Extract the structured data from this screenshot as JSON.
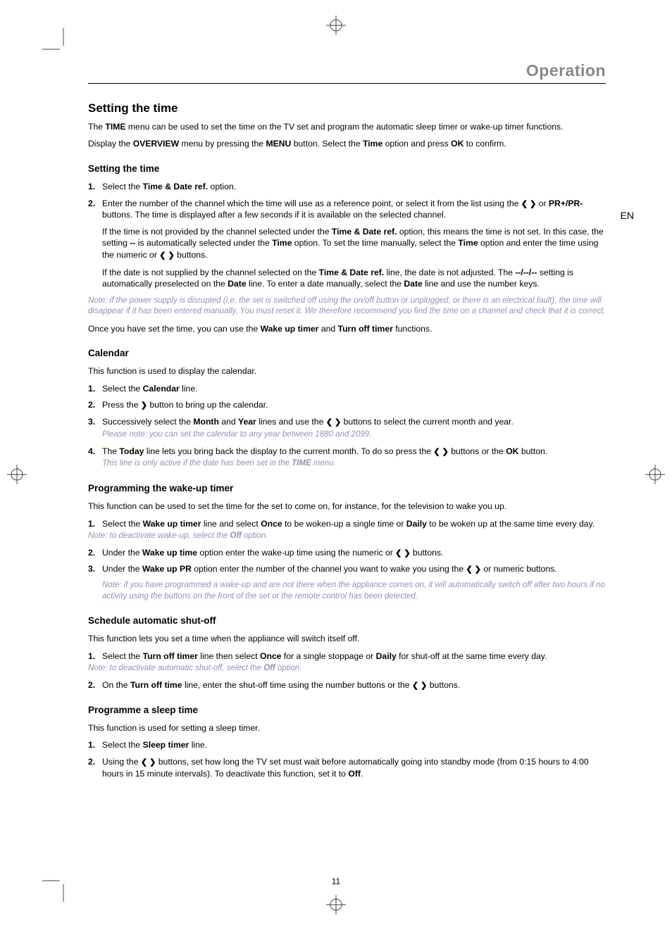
{
  "lang": "EN",
  "header": "Operation",
  "h1": "Setting the time",
  "intro_p1a": "The ",
  "intro_p1b": "TIME",
  "intro_p1c": " menu can be used to set the time on the TV set and program the automatic sleep timer or wake-up timer functions.",
  "intro_p2a": "Display the ",
  "intro_p2b": "OVERVIEW",
  "intro_p2c": " menu by pressing the ",
  "intro_p2d": "MENU",
  "intro_p2e": " button. Select the ",
  "intro_p2f": "Time",
  "intro_p2g": " option and press ",
  "intro_p2h": "OK",
  "intro_p2i": " to confirm.",
  "s1": {
    "title": "Setting the time",
    "li1a": "Select the ",
    "li1b": "Time & Date ref.",
    "li1c": " option.",
    "li2a": "Enter the number of the channel which the time will use as a reference point, or select it from the list using the ",
    "li2b": " or ",
    "li2c": "PR+/PR-",
    "li2d": " buttons. The time is displayed after a few seconds if it is available on the selected channel.",
    "li2p2a": "If the time is not provided by the channel selected under the ",
    "li2p2b": "Time & Date ref.",
    "li2p2c": " option, this means the time is not set. In this case, the setting ",
    "li2p2d": "--",
    "li2p2e": " is automatically selected under the ",
    "li2p2f": "Time",
    "li2p2g": " option. To set the time manually, select the ",
    "li2p2h": "Time",
    "li2p2i": " option and enter the time using the numeric or ",
    "li2p2j": " buttons.",
    "li2p3a": "If the date is not supplied by the channel selected on the ",
    "li2p3b": "Time & Date ref.",
    "li2p3c": " line, the date is not adjusted. The ",
    "li2p3d": "--/--/--",
    "li2p3e": " setting is automatically preselected on the ",
    "li2p3f": "Date",
    "li2p3g": " line. To enter a date manually, select the ",
    "li2p3h": "Date",
    "li2p3i": " line and use the number keys.",
    "note": "Note: if the power supply is disrupted (i.e. the set is switched off using the on/off button or unplugged, or there is an electrical fault), the time will disappear if it has been entered manually. You must reset it. We therefore recommend you find the time on a channel and check that it is correct.",
    "after_a": "Once you have set the time, you can use the ",
    "after_b": "Wake up timer",
    "after_c": " and ",
    "after_d": "Turn off timer",
    "after_e": " functions."
  },
  "s2": {
    "title": "Calendar",
    "intro": "This function is used to display the calendar.",
    "li1a": "Select the ",
    "li1b": "Calendar",
    "li1c": " line.",
    "li2a": "Press the ",
    "li2b": " button to bring up the calendar.",
    "li3a": "Successively select the ",
    "li3b": "Month",
    "li3c": " and ",
    "li3d": "Year",
    "li3e": " lines and use the ",
    "li3f": " buttons to select the current month and year.",
    "li3note": "Please note: you can set the calendar to any year between 1880 and 2099.",
    "li4a": "The ",
    "li4b": "Today",
    "li4c": " line lets you bring back the display to the current month. To do so press the ",
    "li4d": " buttons or the ",
    "li4e": "OK",
    "li4f": " button.",
    "li4note_a": "This line is only active if the date has been set in the ",
    "li4note_b": "TIME",
    "li4note_c": " menu."
  },
  "s3": {
    "title": "Programming the wake-up timer",
    "intro": "This function can be used to set the time for the set to come on, for instance, for the television to wake you up.",
    "li1a": "Select the ",
    "li1b": "Wake up timer",
    "li1c": " line and select ",
    "li1d": "Once",
    "li1e": " to be woken-up a single time or ",
    "li1f": "Daily",
    "li1g": " to be woken up at the same time every day.",
    "li1note_a": "Note: to deactivate wake-up, select the ",
    "li1note_b": "Off",
    "li1note_c": " option.",
    "li2a": "Under the ",
    "li2b": "Wake up time",
    "li2c": " option enter the wake-up time using the numeric or ",
    "li2d": " buttons.",
    "li3a": "Under the ",
    "li3b": "Wake up PR",
    "li3c": " option enter the number of the channel you want to wake you using the ",
    "li3d": " or numeric buttons.",
    "note": "Note: if you have programmed a wake-up and are not there when the appliance comes on, it will automatically switch off after two hours if no activity using the buttons on the front of the set or the remote control has been detected."
  },
  "s4": {
    "title": "Schedule automatic shut-off",
    "intro": "This function lets you set a time when the appliance will switch itself off.",
    "li1a": "Select the ",
    "li1b": "Turn off timer",
    "li1c": " line then select ",
    "li1d": "Once",
    "li1e": " for a single stoppage or ",
    "li1f": "Daily",
    "li1g": " for shut-off at the same time every day.",
    "li1note_a": "Note: to deactivate automatic shut-off, select the ",
    "li1note_b": "Off",
    "li1note_c": " option.",
    "li2a": "On the ",
    "li2b": "Turn off time",
    "li2c": " line, enter the shut-off time using the number buttons or the ",
    "li2d": " buttons."
  },
  "s5": {
    "title": "Programme a sleep time",
    "intro": "This function is used for setting a sleep timer.",
    "li1a": "Select the ",
    "li1b": "Sleep timer",
    "li1c": " line.",
    "li2a": "Using the ",
    "li2b": " buttons, set how long the TV set must wait before automatically going into standby mode (from 0:15 hours to 4:00 hours in 15 minute intervals). To deactivate this function, set it to ",
    "li2c": "Off",
    "li2d": "."
  },
  "labels": {
    "n1": "1.",
    "n2": "2.",
    "n3": "3.",
    "n4": "4.",
    "left_arrow": "❮",
    "right_arrow": "❯",
    "lr_arrow": "❮ ❯"
  },
  "page_num": "11"
}
